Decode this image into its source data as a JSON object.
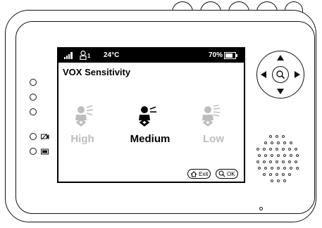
{
  "status_bar": {
    "temperature": "24°C",
    "battery": "70%",
    "camera_index": "1"
  },
  "screen": {
    "title": "VOX Sensitivity",
    "options": [
      {
        "label": "High",
        "selected": false
      },
      {
        "label": "Medium",
        "selected": true
      },
      {
        "label": "Low",
        "selected": false
      }
    ],
    "exit_label": "Exit",
    "ok_label": "OK"
  },
  "colors": {
    "selected": "#000000",
    "unselected": "#bdbdbd",
    "status_bg": "#000000"
  }
}
